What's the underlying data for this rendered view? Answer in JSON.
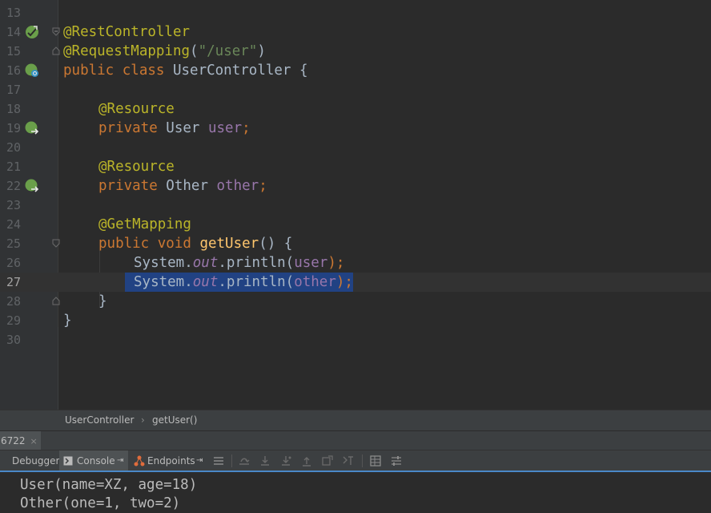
{
  "editor": {
    "line_numbers": [
      "13",
      "14",
      "15",
      "16",
      "17",
      "18",
      "19",
      "20",
      "21",
      "22",
      "23",
      "24",
      "25",
      "26",
      "27",
      "28",
      "29",
      "30"
    ],
    "current_line": "27",
    "code": {
      "l14": "@RestController",
      "l15_ann": "@RequestMapping",
      "l15_open": "(",
      "l15_str": "\"/user\"",
      "l15_close": ")",
      "l16_kw": "public class ",
      "l16_name": "UserController {",
      "l18": "@Resource",
      "l19_kw": "private ",
      "l19_type": "User ",
      "l19_field": "user",
      "l19_semi": ";",
      "l21": "@Resource",
      "l22_kw": "private ",
      "l22_type": "Other ",
      "l22_field": "other",
      "l22_semi": ";",
      "l24": "@GetMapping",
      "l25_kw": "public void ",
      "l25_method": "getUser",
      "l25_rest": "() {",
      "l26_a": "System.",
      "l26_out": "out",
      "l26_b": ".println(",
      "l26_arg": "user",
      "l26_c": ");",
      "l27_a": "System.",
      "l27_out": "out",
      "l27_b": ".println(",
      "l27_arg": "other",
      "l27_c": ");",
      "l28": "}",
      "l29": "}"
    },
    "gutter_icons": {
      "l14": "spring-bean-icon",
      "l16": "spring-bean-search-icon",
      "l19": "injection-point-icon",
      "l22": "injection-point-icon"
    }
  },
  "breadcrumb": {
    "class_name": "UserController",
    "separator": "›",
    "method_name": "getUser()"
  },
  "run_panel": {
    "tab_label": "6722",
    "tab_close": "×",
    "debugger_label": "Debugger",
    "console_label": "Console",
    "endpoints_label": "Endpoints",
    "pin_glyph": "⇥"
  },
  "console": {
    "lines": [
      "User(name=XZ, age=18)",
      "Other(one=1, two=2)"
    ]
  },
  "colors": {
    "background": "#2b2b2b",
    "annotation": "#bbb529",
    "keyword": "#cc7832",
    "string": "#6a8759",
    "field": "#9876aa",
    "method": "#ffc66d",
    "selection": "#214283",
    "spring_green": "#6a9f4a"
  }
}
